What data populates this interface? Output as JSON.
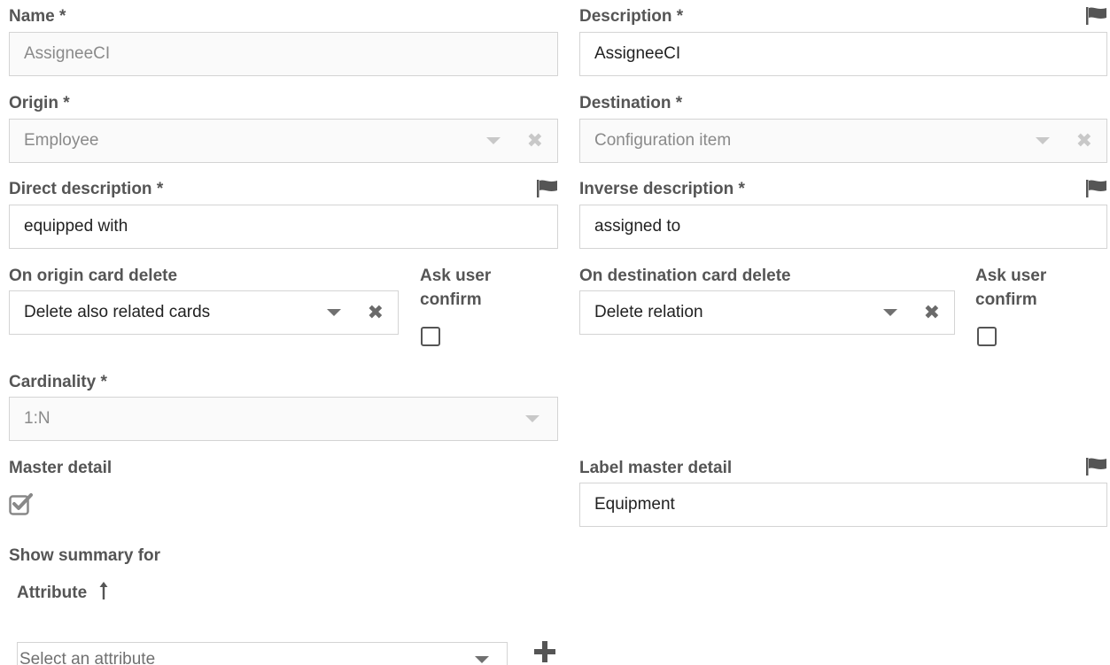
{
  "form": {
    "name": {
      "label": "Name *",
      "value": "AssigneeCI"
    },
    "description": {
      "label": "Description *",
      "value": "AssigneeCI"
    },
    "origin": {
      "label": "Origin *",
      "value": "Employee"
    },
    "destination": {
      "label": "Destination *",
      "value": "Configuration item"
    },
    "direct_description": {
      "label": "Direct description *",
      "value": "equipped with"
    },
    "inverse_description": {
      "label": "Inverse description *",
      "value": "assigned to"
    },
    "on_origin_card_delete": {
      "label": "On origin card delete",
      "value": "Delete also related cards"
    },
    "ask_user_confirm_origin": {
      "label_line1": "Ask user",
      "label_line2": "confirm",
      "checked": false
    },
    "on_destination_card_delete": {
      "label": "On destination card delete",
      "value": "Delete relation"
    },
    "ask_user_confirm_destination": {
      "label_line1": "Ask user",
      "label_line2": "confirm",
      "checked": false
    },
    "cardinality": {
      "label": "Cardinality *",
      "value": "1:N"
    },
    "master_detail": {
      "label": "Master detail",
      "checked": true
    },
    "label_master_detail": {
      "label": "Label master detail",
      "value": "Equipment"
    },
    "show_summary_for": {
      "label": "Show summary for"
    },
    "attribute": {
      "header": "Attribute",
      "sort_icon": "arrow-up-icon",
      "placeholder": "Select an attribute"
    }
  },
  "icons": {
    "translation": "flag-icon",
    "dropdown": "caret-down-icon",
    "clear": "clear-x-icon",
    "add": "plus-icon",
    "checkbox_checked": "checked-checkbox-icon"
  },
  "colors": {
    "label": "#555555",
    "border": "#d4d4d4",
    "readonly_bg": "#fafafa",
    "readonly_text": "#8a8a8a",
    "icon": "#555555",
    "disabled_icon": "#c8c8c8"
  }
}
